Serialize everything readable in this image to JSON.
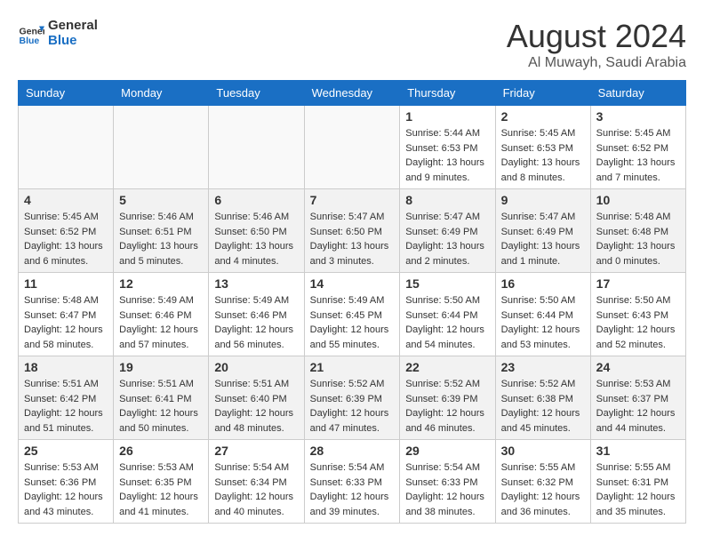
{
  "header": {
    "logo_line1": "General",
    "logo_line2": "Blue",
    "month_title": "August 2024",
    "subtitle": "Al Muwayh, Saudi Arabia"
  },
  "weekdays": [
    "Sunday",
    "Monday",
    "Tuesday",
    "Wednesday",
    "Thursday",
    "Friday",
    "Saturday"
  ],
  "weeks": [
    [
      {
        "day": "",
        "info": ""
      },
      {
        "day": "",
        "info": ""
      },
      {
        "day": "",
        "info": ""
      },
      {
        "day": "",
        "info": ""
      },
      {
        "day": "1",
        "info": "Sunrise: 5:44 AM\nSunset: 6:53 PM\nDaylight: 13 hours\nand 9 minutes."
      },
      {
        "day": "2",
        "info": "Sunrise: 5:45 AM\nSunset: 6:53 PM\nDaylight: 13 hours\nand 8 minutes."
      },
      {
        "day": "3",
        "info": "Sunrise: 5:45 AM\nSunset: 6:52 PM\nDaylight: 13 hours\nand 7 minutes."
      }
    ],
    [
      {
        "day": "4",
        "info": "Sunrise: 5:45 AM\nSunset: 6:52 PM\nDaylight: 13 hours\nand 6 minutes."
      },
      {
        "day": "5",
        "info": "Sunrise: 5:46 AM\nSunset: 6:51 PM\nDaylight: 13 hours\nand 5 minutes."
      },
      {
        "day": "6",
        "info": "Sunrise: 5:46 AM\nSunset: 6:50 PM\nDaylight: 13 hours\nand 4 minutes."
      },
      {
        "day": "7",
        "info": "Sunrise: 5:47 AM\nSunset: 6:50 PM\nDaylight: 13 hours\nand 3 minutes."
      },
      {
        "day": "8",
        "info": "Sunrise: 5:47 AM\nSunset: 6:49 PM\nDaylight: 13 hours\nand 2 minutes."
      },
      {
        "day": "9",
        "info": "Sunrise: 5:47 AM\nSunset: 6:49 PM\nDaylight: 13 hours\nand 1 minute."
      },
      {
        "day": "10",
        "info": "Sunrise: 5:48 AM\nSunset: 6:48 PM\nDaylight: 13 hours\nand 0 minutes."
      }
    ],
    [
      {
        "day": "11",
        "info": "Sunrise: 5:48 AM\nSunset: 6:47 PM\nDaylight: 12 hours\nand 58 minutes."
      },
      {
        "day": "12",
        "info": "Sunrise: 5:49 AM\nSunset: 6:46 PM\nDaylight: 12 hours\nand 57 minutes."
      },
      {
        "day": "13",
        "info": "Sunrise: 5:49 AM\nSunset: 6:46 PM\nDaylight: 12 hours\nand 56 minutes."
      },
      {
        "day": "14",
        "info": "Sunrise: 5:49 AM\nSunset: 6:45 PM\nDaylight: 12 hours\nand 55 minutes."
      },
      {
        "day": "15",
        "info": "Sunrise: 5:50 AM\nSunset: 6:44 PM\nDaylight: 12 hours\nand 54 minutes."
      },
      {
        "day": "16",
        "info": "Sunrise: 5:50 AM\nSunset: 6:44 PM\nDaylight: 12 hours\nand 53 minutes."
      },
      {
        "day": "17",
        "info": "Sunrise: 5:50 AM\nSunset: 6:43 PM\nDaylight: 12 hours\nand 52 minutes."
      }
    ],
    [
      {
        "day": "18",
        "info": "Sunrise: 5:51 AM\nSunset: 6:42 PM\nDaylight: 12 hours\nand 51 minutes."
      },
      {
        "day": "19",
        "info": "Sunrise: 5:51 AM\nSunset: 6:41 PM\nDaylight: 12 hours\nand 50 minutes."
      },
      {
        "day": "20",
        "info": "Sunrise: 5:51 AM\nSunset: 6:40 PM\nDaylight: 12 hours\nand 48 minutes."
      },
      {
        "day": "21",
        "info": "Sunrise: 5:52 AM\nSunset: 6:39 PM\nDaylight: 12 hours\nand 47 minutes."
      },
      {
        "day": "22",
        "info": "Sunrise: 5:52 AM\nSunset: 6:39 PM\nDaylight: 12 hours\nand 46 minutes."
      },
      {
        "day": "23",
        "info": "Sunrise: 5:52 AM\nSunset: 6:38 PM\nDaylight: 12 hours\nand 45 minutes."
      },
      {
        "day": "24",
        "info": "Sunrise: 5:53 AM\nSunset: 6:37 PM\nDaylight: 12 hours\nand 44 minutes."
      }
    ],
    [
      {
        "day": "25",
        "info": "Sunrise: 5:53 AM\nSunset: 6:36 PM\nDaylight: 12 hours\nand 43 minutes."
      },
      {
        "day": "26",
        "info": "Sunrise: 5:53 AM\nSunset: 6:35 PM\nDaylight: 12 hours\nand 41 minutes."
      },
      {
        "day": "27",
        "info": "Sunrise: 5:54 AM\nSunset: 6:34 PM\nDaylight: 12 hours\nand 40 minutes."
      },
      {
        "day": "28",
        "info": "Sunrise: 5:54 AM\nSunset: 6:33 PM\nDaylight: 12 hours\nand 39 minutes."
      },
      {
        "day": "29",
        "info": "Sunrise: 5:54 AM\nSunset: 6:33 PM\nDaylight: 12 hours\nand 38 minutes."
      },
      {
        "day": "30",
        "info": "Sunrise: 5:55 AM\nSunset: 6:32 PM\nDaylight: 12 hours\nand 36 minutes."
      },
      {
        "day": "31",
        "info": "Sunrise: 5:55 AM\nSunset: 6:31 PM\nDaylight: 12 hours\nand 35 minutes."
      }
    ]
  ]
}
